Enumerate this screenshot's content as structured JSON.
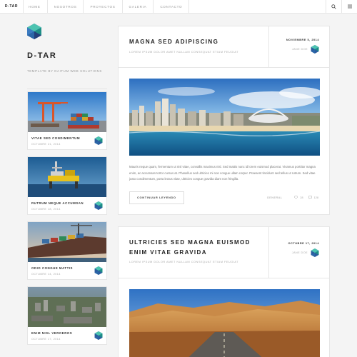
{
  "nav": {
    "brand": "D-TAR",
    "items": [
      "HOME",
      "NOSOTROS",
      "PROYECTOS",
      "GALERIA",
      "CONTACTO"
    ],
    "icons": [
      "search-icon",
      "menu-icon"
    ]
  },
  "sidebar": {
    "title": "D-TAR",
    "tagline": "TEMPLATE BY DAITUM WEB SOLUTIONS",
    "cards": [
      {
        "title": "VITAE SED CONDIMENTUM",
        "date": "OCTUBRE 21, 2014",
        "image": "shipping-port"
      },
      {
        "title": "RUTRUM NEQUE ACCUMSAN",
        "date": "OCTUBRE 18, 2014",
        "image": "offshore-rig"
      },
      {
        "title": "ODIO CONGUE MATTIS",
        "date": "OCTUBRE 14, 2014",
        "image": "cargo-ship"
      },
      {
        "title": "ENIM NISL VEROEROS",
        "date": "OCTUBRE 17, 2014",
        "image": "aerial-city"
      }
    ]
  },
  "posts": [
    {
      "title_lines": [
        "MAGNA SED ADIPISCING"
      ],
      "excerpt": "LOREM IPSUM DOLOR AMET NULLAM CONSEQUAT ETIAM FEUGIAT",
      "date": "NOVIEMBRE 5, 2014",
      "author": "JANE DOE",
      "image": "coastal-city",
      "body": "Mauris neque quam, fermentum ut nisl vitae, convallis maximus nisl. Sed mattis nunc id lorem euismod placerat. Vivamus porttitor magna enim, ac accumsan tortor cursus at. Phasellus sed ultricies mi non congue ullam corper. Praesent tincidunt sed tellus ut rutrum. Sed vitae justo condimentum, porta lectus vitae, ultricies congue gravida diam non fringilla.",
      "read_more": "CONTINUAR LEYENDO",
      "category": "GENERAL",
      "likes": "28",
      "comments": "128"
    },
    {
      "title_lines": [
        "ULTRICIES SED MAGNA EUISMOD",
        "ENIM VITAE GRAVIDA"
      ],
      "excerpt": "LOREM IPSUM DOLOR AMET NULLAM CONSEQUAT ETIAM FEUGIAT",
      "date": "OCTUBRE 17, 2014",
      "author": "JANE DOE",
      "image": "desert-road"
    }
  ],
  "colors": {
    "accent_teal": "#2fa89a",
    "accent_blue": "#2a5c9e",
    "border": "#e6e6e6"
  }
}
